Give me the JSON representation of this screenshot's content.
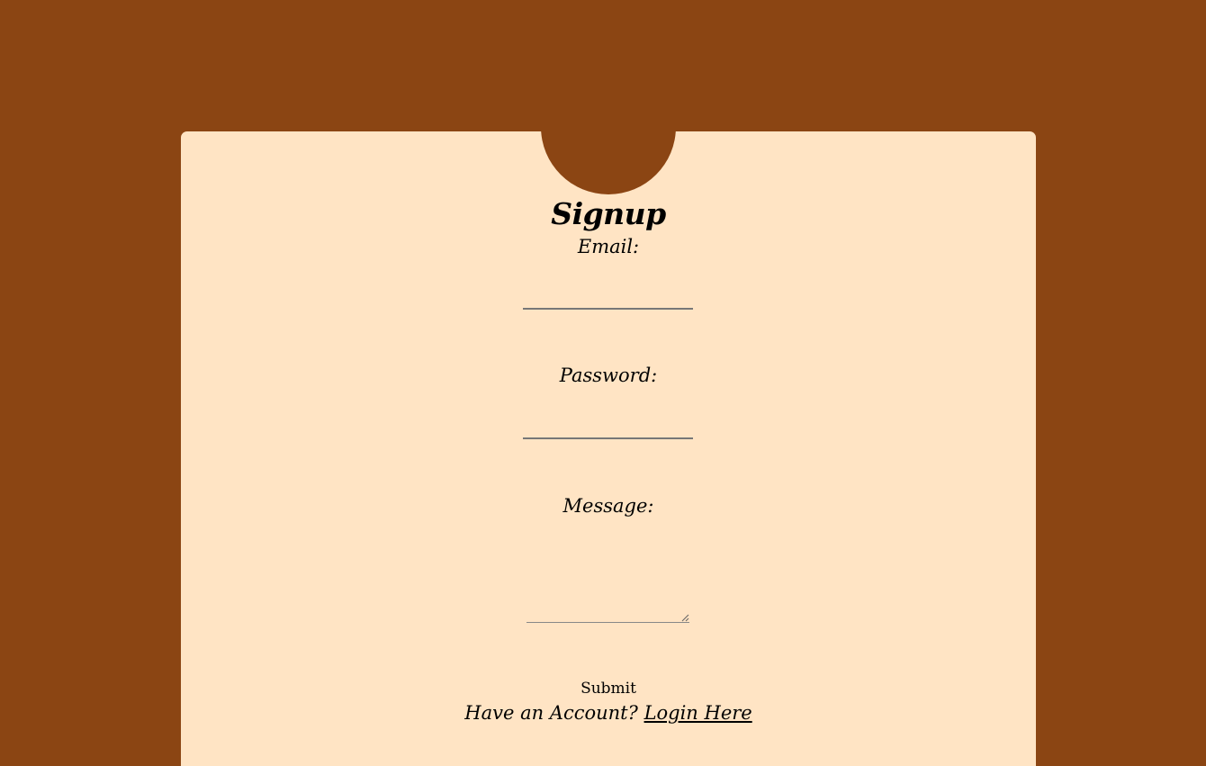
{
  "form": {
    "title": "Signup",
    "email_label": "Email:",
    "email_value": "",
    "password_label": "Password:",
    "password_value": "",
    "message_label": "Message:",
    "message_value": "",
    "submit_label": "Submit",
    "footer_text": "Have an Account?",
    "login_link": "Login Here"
  },
  "colors": {
    "background": "#8b4513",
    "card": "#ffe4c4",
    "text": "#000000"
  }
}
